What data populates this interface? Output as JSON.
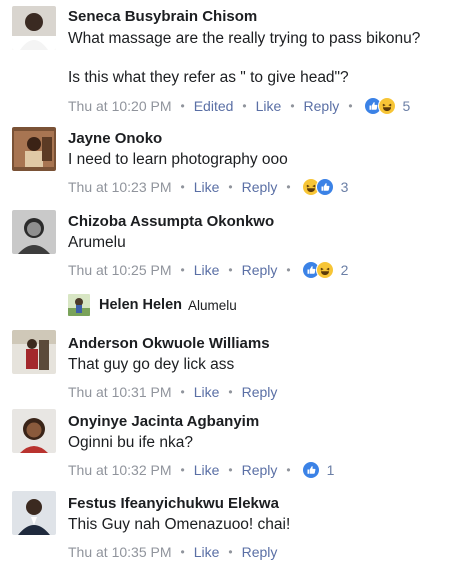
{
  "comments": [
    {
      "author": "Seneca Busybrain Chisom",
      "lines": [
        "What massage are the really trying to pass bikonu?",
        "Is this what they refer as \" to give head\"?"
      ],
      "time": "Thu at 10:20 PM",
      "edited": "Edited",
      "like": "Like",
      "reply": "Reply",
      "reaction_count": "5"
    },
    {
      "author": "Jayne Onoko",
      "lines": [
        "I need to learn photography  ooo"
      ],
      "time": "Thu at 10:23 PM",
      "like": "Like",
      "reply": "Reply",
      "reaction_count": "3"
    },
    {
      "author": "Chizoba Assumpta Okonkwo",
      "lines": [
        "Arumelu"
      ],
      "time": "Thu at 10:25 PM",
      "like": "Like",
      "reply": "Reply",
      "reaction_count": "2"
    },
    {
      "author": "Anderson Okwuole Williams",
      "lines": [
        "That guy go dey lick ass"
      ],
      "time": "Thu at 10:31 PM",
      "like": "Like",
      "reply": "Reply"
    },
    {
      "author": "Onyinye Jacinta Agbanyim",
      "lines": [
        "Oginni bu ife nka?"
      ],
      "time": "Thu at 10:32 PM",
      "like": "Like",
      "reply": "Reply",
      "reaction_count": "1"
    },
    {
      "author": "Festus Ifeanyichukwu Elekwa",
      "lines": [
        "This Guy nah Omenazuoo! chai!"
      ],
      "time": "Thu at 10:35 PM",
      "like": "Like",
      "reply": "Reply"
    }
  ],
  "nested_reply": {
    "author": "Helen Helen",
    "text": "Alumelu"
  },
  "colors": {
    "author_text": "#1c1e21",
    "meta_text": "#90949c",
    "action_link": "#5a6fa5",
    "like_reaction": "#3b82e6",
    "haha_reaction": "#f7c536"
  },
  "icons": [
    "like-reaction-icon",
    "haha-reaction-icon"
  ]
}
